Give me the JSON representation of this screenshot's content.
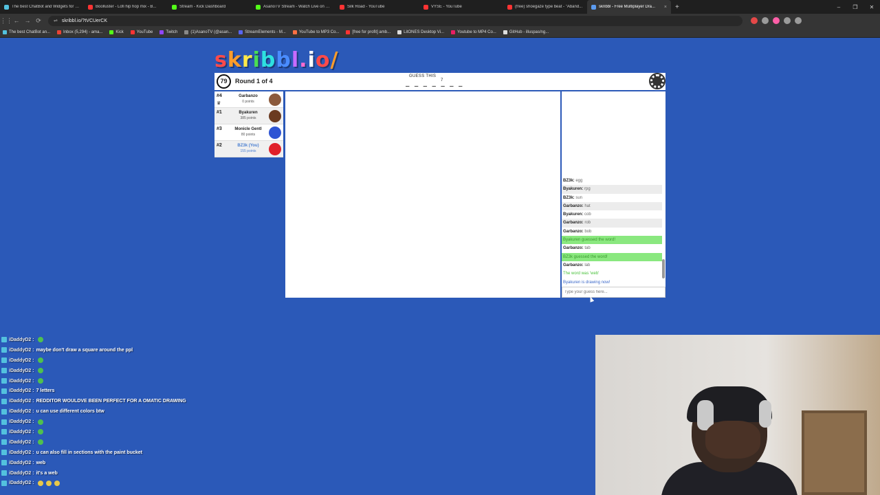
{
  "browser": {
    "tabs": [
      {
        "label": "The best ChatBot and Widgets for K...",
        "color": "#53c1de",
        "active": false
      },
      {
        "label": "Boolluster - Lofi hip hop mix - B...",
        "color": "#ff3333",
        "active": false
      },
      {
        "label": "Stream - Kick Dashboard",
        "color": "#53fc18",
        "active": false
      },
      {
        "label": "AsanoTV Stream - Watch Live on Kick",
        "color": "#53fc18",
        "active": false
      },
      {
        "label": "Silk Road - YouTube",
        "color": "#ff3333",
        "active": false
      },
      {
        "label": "VYSE - YouTube",
        "color": "#ff3333",
        "active": false
      },
      {
        "label": "(free) shoegaze type beat - \"Aband...",
        "color": "#ff3333",
        "active": false
      },
      {
        "label": "skribbl - Free Multiplayer Dra...",
        "color": "#5b9bf0",
        "active": true
      }
    ],
    "tab_close": "×",
    "new_tab": "+",
    "window_controls": [
      "–",
      "❐",
      "✕"
    ],
    "url": "skribbl.io/?tVCUerCK",
    "bookmarks": [
      {
        "label": "The best ChatBot an...",
        "color": "#53c1de"
      },
      {
        "label": "Inbox (5,294) - ama...",
        "color": "#ea4335"
      },
      {
        "label": "Kick",
        "color": "#53fc18"
      },
      {
        "label": "YouTube",
        "color": "#ff3333"
      },
      {
        "label": "Twitch",
        "color": "#9146ff"
      },
      {
        "label": "(1)AsanoTV (@asan...",
        "color": "#888888"
      },
      {
        "label": "StreamElements - M...",
        "color": "#5865f2"
      },
      {
        "label": "YouTube to MP3 Co...",
        "color": "#ff7043"
      },
      {
        "label": "[free for profit] amb...",
        "color": "#ff3333"
      },
      {
        "label": "LitONES Desktop Vi...",
        "color": "#dddddd"
      },
      {
        "label": "Youtube to MP4 Co...",
        "color": "#e91e63"
      },
      {
        "label": "GitHub - illuspas/ng...",
        "color": "#dddddd"
      }
    ]
  },
  "game": {
    "logo": "skribbl.io/",
    "logo_colors": [
      "#ff4a4a",
      "#ff9c2a",
      "#ffe94a",
      "#4ade53",
      "#2ee0e0",
      "#4a8cff",
      "#c86bff",
      "#ff6bd0",
      "#ffffff",
      "#ff4a4a",
      "#ff9c2a"
    ],
    "timer": "79",
    "round": "Round 1 of 4",
    "guess_label": "GUESS THIS",
    "word_hint": "_ _ _ _ _ _ _",
    "word_length": "7",
    "players": [
      {
        "rank": "#4",
        "name": "Garbanzo",
        "points": "0 points",
        "avatar_color": "#8b5a3c",
        "me": false,
        "drawing": true
      },
      {
        "rank": "#1",
        "name": "Byakuren",
        "points": "385 points",
        "avatar_color": "#6b3a20",
        "me": false,
        "drawing": false
      },
      {
        "rank": "#3",
        "name": "Monicle Gentl",
        "points": "80 points",
        "avatar_color": "#2f55d4",
        "me": false,
        "drawing": false
      },
      {
        "rank": "#2",
        "name": "BZ3k (You)",
        "points": "155 points",
        "avatar_color": "#e0202a",
        "me": true,
        "drawing": false
      }
    ],
    "chat": [
      {
        "who": "BZ3k:",
        "text": "egg",
        "type": "msg"
      },
      {
        "who": "Byakuren:",
        "text": "rpg",
        "type": "msg"
      },
      {
        "who": "BZ3k:",
        "text": "sun",
        "type": "msg"
      },
      {
        "who": "Garbanzo:",
        "text": "hat",
        "type": "msg"
      },
      {
        "who": "Byakuren:",
        "text": "cob",
        "type": "msg"
      },
      {
        "who": "Garbanzo:",
        "text": "rob",
        "type": "msg"
      },
      {
        "who": "Garbanzo:",
        "text": "bob",
        "type": "msg"
      },
      {
        "who": "",
        "text": "Byakuren guessed the word!",
        "type": "sys-green"
      },
      {
        "who": "Garbanzo:",
        "text": "tab",
        "type": "msg"
      },
      {
        "who": "",
        "text": "BZ3k guessed the word!",
        "type": "sys-green"
      },
      {
        "who": "Garbanzo:",
        "text": "lab",
        "type": "msg"
      },
      {
        "who": "",
        "text": "The word was 'web'",
        "type": "sys-lightgreen"
      },
      {
        "who": "",
        "text": "Byakuren is drawing now!",
        "type": "sys-blue"
      }
    ],
    "guess_placeholder": "Type your guess here..."
  },
  "stream_chat": [
    {
      "name": "iDaddyD2 :",
      "text": "",
      "emotes": 1,
      "emote_type": "g"
    },
    {
      "name": "iDaddyD2 :",
      "text": "maybe don't draw a square around the ppl",
      "emotes": 0,
      "emote_type": "g"
    },
    {
      "name": "iDaddyD2 :",
      "text": "",
      "emotes": 1,
      "emote_type": "g"
    },
    {
      "name": "iDaddyD2 :",
      "text": "",
      "emotes": 1,
      "emote_type": "g"
    },
    {
      "name": "iDaddyD2 :",
      "text": "",
      "emotes": 1,
      "emote_type": "g"
    },
    {
      "name": "iDaddyD2 :",
      "text": "7 letters",
      "emotes": 0,
      "emote_type": "g"
    },
    {
      "name": "iDaddyD2 :",
      "text": "REDDITOR WOULDVE BEEN PERFECT FOR A OMATIC DRAWING",
      "emotes": 0,
      "emote_type": "g"
    },
    {
      "name": "iDaddyD2 :",
      "text": "u can use different colors btw",
      "emotes": 0,
      "emote_type": "g"
    },
    {
      "name": "iDaddyD2 :",
      "text": "",
      "emotes": 1,
      "emote_type": "g"
    },
    {
      "name": "iDaddyD2 :",
      "text": "",
      "emotes": 1,
      "emote_type": "g"
    },
    {
      "name": "iDaddyD2 :",
      "text": "",
      "emotes": 1,
      "emote_type": "g"
    },
    {
      "name": "iDaddyD2 :",
      "text": "u can also fill in sections with the paint bucket",
      "emotes": 0,
      "emote_type": "g"
    },
    {
      "name": "iDaddyD2 :",
      "text": "web",
      "emotes": 0,
      "emote_type": "g"
    },
    {
      "name": "iDaddyD2 :",
      "text": "it's a web",
      "emotes": 0,
      "emote_type": "g"
    },
    {
      "name": "iDaddyD2 :",
      "text": "",
      "emotes": 3,
      "emote_type": "y"
    }
  ]
}
